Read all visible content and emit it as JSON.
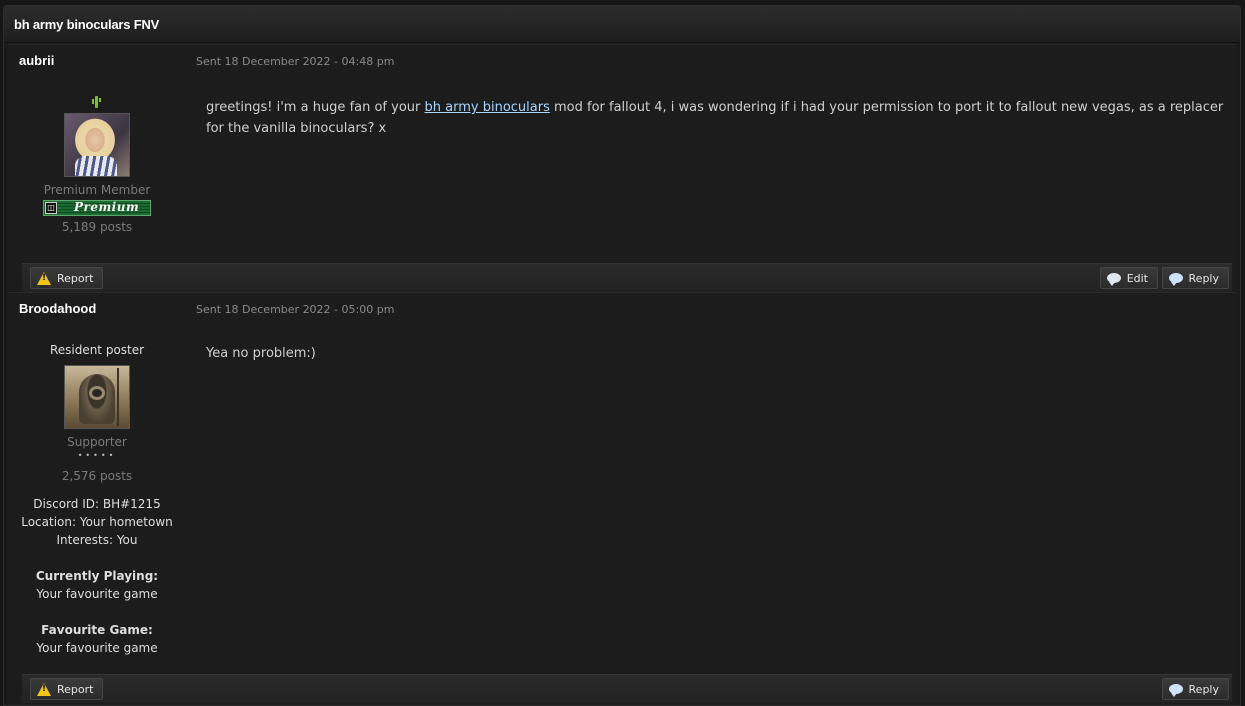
{
  "topic": {
    "title": "bh army binoculars FNV"
  },
  "posts": [
    {
      "author": "aubrii",
      "date": "Sent 18 December 2022 - 04:48 pm",
      "online_icon": "online-cactus-icon",
      "group": "Premium Member",
      "badge_text": "Premium",
      "post_count": "5,189 posts",
      "body_before": "greetings! i'm a huge fan of your ",
      "body_link": "bh army binoculars",
      "body_after": " mod for fallout 4, i was wondering if i had your permission to port it to fallout new vegas, as a replacer for the vanilla binoculars? x",
      "buttons": {
        "report": "Report",
        "edit": "Edit",
        "reply": "Reply"
      }
    },
    {
      "author": "Broodahood",
      "date": "Sent 18 December 2022 - 05:00 pm",
      "title": "Resident poster",
      "group": "Supporter",
      "pips": "•••••",
      "post_count": "2,576 posts",
      "discord": "Discord ID: BH#1215",
      "location": "Location: Your hometown",
      "interests": "Interests: You",
      "currently_playing_label": "Currently Playing:",
      "currently_playing_value": "Your favourite game",
      "favourite_game_label": "Favourite Game:",
      "favourite_game_value": "Your favourite game",
      "body": "Yea no problem:)",
      "buttons": {
        "report": "Report",
        "reply": "Reply"
      }
    }
  ],
  "colors": {
    "link": "#a8d4ff",
    "badge_green": "#1c6a32",
    "warn": "#f0c419"
  }
}
